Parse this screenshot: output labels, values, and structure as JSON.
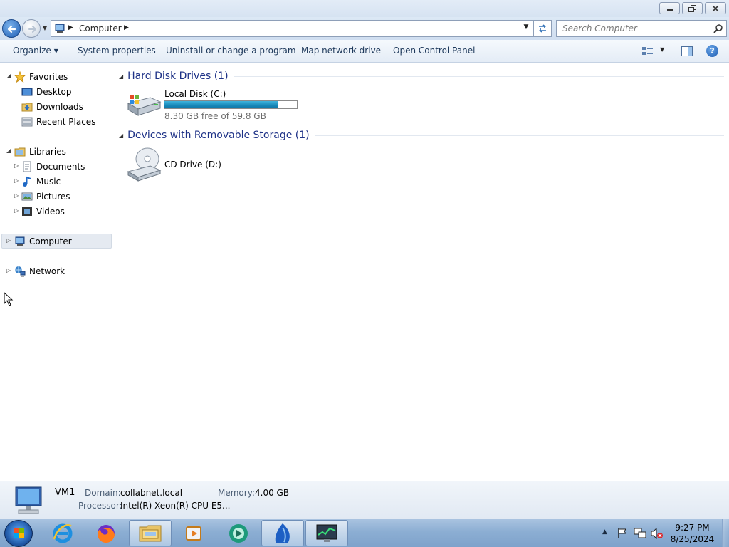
{
  "search": {
    "placeholder": "Search Computer"
  },
  "address": {
    "path": "Computer"
  },
  "toolbar": {
    "organize": "Organize",
    "system_properties": "System properties",
    "uninstall": "Uninstall or change a program",
    "map_drive": "Map network drive",
    "control_panel": "Open Control Panel"
  },
  "nav": {
    "favorites": "Favorites",
    "desktop": "Desktop",
    "downloads": "Downloads",
    "recent_places": "Recent Places",
    "libraries": "Libraries",
    "documents": "Documents",
    "music": "Music",
    "pictures": "Pictures",
    "videos": "Videos",
    "computer": "Computer",
    "network": "Network"
  },
  "content": {
    "hdd_group": "Hard Disk Drives (1)",
    "removable_group": "Devices with Removable Storage (1)",
    "local_disk": {
      "name": "Local Disk (C:)",
      "free_text": "8.30 GB free of 59.8 GB",
      "used_fraction": 0.861
    },
    "cd_drive": {
      "name": "CD Drive (D:)"
    }
  },
  "details": {
    "computer_name": "VM1",
    "domain_label": "Domain:",
    "domain_value": "collabnet.local",
    "memory_label": "Memory:",
    "memory_value": "4.00 GB",
    "processor_label": "Processor:",
    "processor_value": "Intel(R) Xeon(R) CPU E5..."
  },
  "clock": {
    "time": "9:27 PM",
    "date": "8/25/2024"
  },
  "colors": {
    "header_blue": "#1e3287",
    "bar_fill": "#1888b8",
    "selection": "#e5eaf1"
  }
}
